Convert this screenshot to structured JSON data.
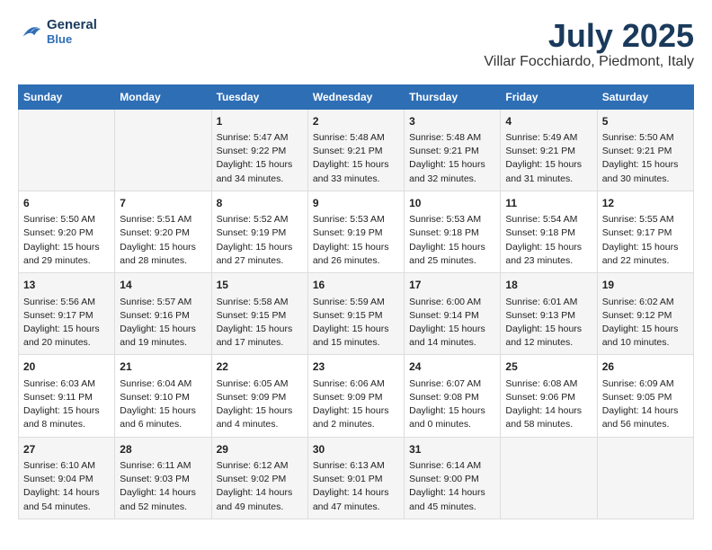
{
  "header": {
    "logo_line1": "General",
    "logo_line2": "Blue",
    "title": "July 2025",
    "subtitle": "Villar Focchiardo, Piedmont, Italy"
  },
  "calendar": {
    "days_of_week": [
      "Sunday",
      "Monday",
      "Tuesday",
      "Wednesday",
      "Thursday",
      "Friday",
      "Saturday"
    ],
    "weeks": [
      [
        {
          "day": "",
          "content": ""
        },
        {
          "day": "",
          "content": ""
        },
        {
          "day": "1",
          "content": "Sunrise: 5:47 AM\nSunset: 9:22 PM\nDaylight: 15 hours\nand 34 minutes."
        },
        {
          "day": "2",
          "content": "Sunrise: 5:48 AM\nSunset: 9:21 PM\nDaylight: 15 hours\nand 33 minutes."
        },
        {
          "day": "3",
          "content": "Sunrise: 5:48 AM\nSunset: 9:21 PM\nDaylight: 15 hours\nand 32 minutes."
        },
        {
          "day": "4",
          "content": "Sunrise: 5:49 AM\nSunset: 9:21 PM\nDaylight: 15 hours\nand 31 minutes."
        },
        {
          "day": "5",
          "content": "Sunrise: 5:50 AM\nSunset: 9:21 PM\nDaylight: 15 hours\nand 30 minutes."
        }
      ],
      [
        {
          "day": "6",
          "content": "Sunrise: 5:50 AM\nSunset: 9:20 PM\nDaylight: 15 hours\nand 29 minutes."
        },
        {
          "day": "7",
          "content": "Sunrise: 5:51 AM\nSunset: 9:20 PM\nDaylight: 15 hours\nand 28 minutes."
        },
        {
          "day": "8",
          "content": "Sunrise: 5:52 AM\nSunset: 9:19 PM\nDaylight: 15 hours\nand 27 minutes."
        },
        {
          "day": "9",
          "content": "Sunrise: 5:53 AM\nSunset: 9:19 PM\nDaylight: 15 hours\nand 26 minutes."
        },
        {
          "day": "10",
          "content": "Sunrise: 5:53 AM\nSunset: 9:18 PM\nDaylight: 15 hours\nand 25 minutes."
        },
        {
          "day": "11",
          "content": "Sunrise: 5:54 AM\nSunset: 9:18 PM\nDaylight: 15 hours\nand 23 minutes."
        },
        {
          "day": "12",
          "content": "Sunrise: 5:55 AM\nSunset: 9:17 PM\nDaylight: 15 hours\nand 22 minutes."
        }
      ],
      [
        {
          "day": "13",
          "content": "Sunrise: 5:56 AM\nSunset: 9:17 PM\nDaylight: 15 hours\nand 20 minutes."
        },
        {
          "day": "14",
          "content": "Sunrise: 5:57 AM\nSunset: 9:16 PM\nDaylight: 15 hours\nand 19 minutes."
        },
        {
          "day": "15",
          "content": "Sunrise: 5:58 AM\nSunset: 9:15 PM\nDaylight: 15 hours\nand 17 minutes."
        },
        {
          "day": "16",
          "content": "Sunrise: 5:59 AM\nSunset: 9:15 PM\nDaylight: 15 hours\nand 15 minutes."
        },
        {
          "day": "17",
          "content": "Sunrise: 6:00 AM\nSunset: 9:14 PM\nDaylight: 15 hours\nand 14 minutes."
        },
        {
          "day": "18",
          "content": "Sunrise: 6:01 AM\nSunset: 9:13 PM\nDaylight: 15 hours\nand 12 minutes."
        },
        {
          "day": "19",
          "content": "Sunrise: 6:02 AM\nSunset: 9:12 PM\nDaylight: 15 hours\nand 10 minutes."
        }
      ],
      [
        {
          "day": "20",
          "content": "Sunrise: 6:03 AM\nSunset: 9:11 PM\nDaylight: 15 hours\nand 8 minutes."
        },
        {
          "day": "21",
          "content": "Sunrise: 6:04 AM\nSunset: 9:10 PM\nDaylight: 15 hours\nand 6 minutes."
        },
        {
          "day": "22",
          "content": "Sunrise: 6:05 AM\nSunset: 9:09 PM\nDaylight: 15 hours\nand 4 minutes."
        },
        {
          "day": "23",
          "content": "Sunrise: 6:06 AM\nSunset: 9:09 PM\nDaylight: 15 hours\nand 2 minutes."
        },
        {
          "day": "24",
          "content": "Sunrise: 6:07 AM\nSunset: 9:08 PM\nDaylight: 15 hours\nand 0 minutes."
        },
        {
          "day": "25",
          "content": "Sunrise: 6:08 AM\nSunset: 9:06 PM\nDaylight: 14 hours\nand 58 minutes."
        },
        {
          "day": "26",
          "content": "Sunrise: 6:09 AM\nSunset: 9:05 PM\nDaylight: 14 hours\nand 56 minutes."
        }
      ],
      [
        {
          "day": "27",
          "content": "Sunrise: 6:10 AM\nSunset: 9:04 PM\nDaylight: 14 hours\nand 54 minutes."
        },
        {
          "day": "28",
          "content": "Sunrise: 6:11 AM\nSunset: 9:03 PM\nDaylight: 14 hours\nand 52 minutes."
        },
        {
          "day": "29",
          "content": "Sunrise: 6:12 AM\nSunset: 9:02 PM\nDaylight: 14 hours\nand 49 minutes."
        },
        {
          "day": "30",
          "content": "Sunrise: 6:13 AM\nSunset: 9:01 PM\nDaylight: 14 hours\nand 47 minutes."
        },
        {
          "day": "31",
          "content": "Sunrise: 6:14 AM\nSunset: 9:00 PM\nDaylight: 14 hours\nand 45 minutes."
        },
        {
          "day": "",
          "content": ""
        },
        {
          "day": "",
          "content": ""
        }
      ]
    ]
  }
}
